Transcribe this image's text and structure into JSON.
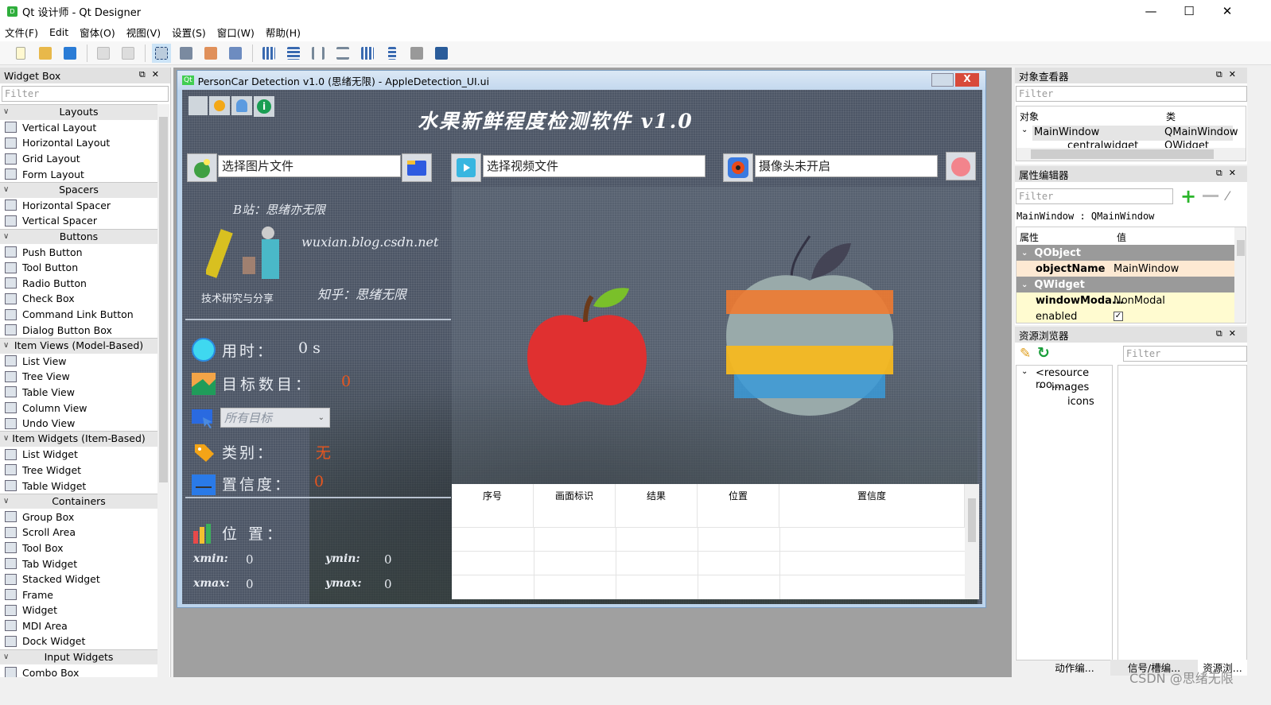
{
  "app": {
    "title": "Qt 设计师 - Qt Designer",
    "icon": "qt-designer-icon"
  },
  "window_controls": {
    "minimize": "—",
    "maximize": "☐",
    "close": "✕"
  },
  "menu": [
    "文件(F)",
    "Edit",
    "窗体(O)",
    "视图(V)",
    "设置(S)",
    "窗口(W)",
    "帮助(H)"
  ],
  "toolbar": [
    "new-file-icon",
    "open-folder-icon",
    "save-icon",
    "copy-icon",
    "paste-icon",
    "edit-widgets-icon",
    "edit-signals-icon",
    "edit-buddies-icon",
    "edit-tab-order-icon",
    "layout-horizontal-icon",
    "layout-vertical-icon",
    "layout-h-splitter-icon",
    "layout-v-splitter-icon",
    "layout-grid-icon",
    "layout-form-icon",
    "break-layout-icon",
    "adjust-size-icon"
  ],
  "widget_box": {
    "title": "Widget Box",
    "filter_placeholder": "Filter",
    "groups": [
      {
        "name": "Layouts",
        "items": [
          "Vertical Layout",
          "Horizontal Layout",
          "Grid Layout",
          "Form Layout"
        ]
      },
      {
        "name": "Spacers",
        "items": [
          "Horizontal Spacer",
          "Vertical Spacer"
        ]
      },
      {
        "name": "Buttons",
        "items": [
          "Push Button",
          "Tool Button",
          "Radio Button",
          "Check Box",
          "Command Link Button",
          "Dialog Button Box"
        ]
      },
      {
        "name": "Item Views (Model-Based)",
        "items": [
          "List View",
          "Tree View",
          "Table View",
          "Column View",
          "Undo View"
        ]
      },
      {
        "name": "Item Widgets (Item-Based)",
        "items": [
          "List Widget",
          "Tree Widget",
          "Table Widget"
        ]
      },
      {
        "name": "Containers",
        "items": [
          "Group Box",
          "Scroll Area",
          "Tool Box",
          "Tab Widget",
          "Stacked Widget",
          "Frame",
          "Widget",
          "MDI Area",
          "Dock Widget"
        ]
      },
      {
        "name": "Input Widgets",
        "items": [
          "Combo Box"
        ]
      }
    ]
  },
  "form": {
    "window_title": "PersonCar Detection v1.0  (思绪无限)   - AppleDetection_UI.ui",
    "heading": "水果新鲜程度检测软件  v1.0",
    "image_path": "选择图片文件",
    "video_path": "选择视频文件",
    "camera_status": "摄像头未开启",
    "bilibili": "B站：思绪亦无限",
    "blog": "wuxian.blog.csdn.net",
    "zhihu": "知乎：思绪无限",
    "logo_caption": "技术研究与分享",
    "time_label": "用时：",
    "time_value": "0 s",
    "count_label": "目标数目：",
    "count_value": "0",
    "target_select": "所有目标",
    "class_label": "类别：",
    "class_value": "无",
    "conf_label": "置信度：",
    "conf_value": "0",
    "pos_label": "位 置：",
    "xmin_label": "xmin:",
    "xmin": "0",
    "ymin_label": "ymin:",
    "ymin": "0",
    "xmax_label": "xmax:",
    "xmax": "0",
    "ymax_label": "ymax:",
    "ymax": "0",
    "table_headers": [
      "序号",
      "画面标识",
      "结果",
      "位置",
      "置信度"
    ],
    "accent": "#e8561e"
  },
  "object_inspector": {
    "title": "对象查看器",
    "filter_placeholder": "Filter",
    "col_object": "对象",
    "col_class": "类",
    "rows": [
      {
        "name": "MainWindow",
        "class": "QMainWindow"
      },
      {
        "name": "centralwidget",
        "class": "QWidget"
      }
    ]
  },
  "property_editor": {
    "title": "属性编辑器",
    "filter_placeholder": "Filter",
    "context": "MainWindow : QMainWindow",
    "col_prop": "属性",
    "col_value": "值",
    "groups": [
      "QObject",
      "QWidget"
    ],
    "props": [
      {
        "k": "objectName",
        "v": "MainWindow"
      },
      {
        "k": "windowModa...",
        "v": "NonModal"
      },
      {
        "k": "enabled",
        "v": "checked"
      }
    ]
  },
  "resource_browser": {
    "title": "资源浏览器",
    "filter_placeholder": "Filter",
    "tree": [
      "<resource roo...",
      "images",
      "icons"
    ]
  },
  "bottom_tabs": [
    "动作编...",
    "信号/槽编...",
    "资源浏..."
  ],
  "watermark": "CSDN @思绪无限"
}
